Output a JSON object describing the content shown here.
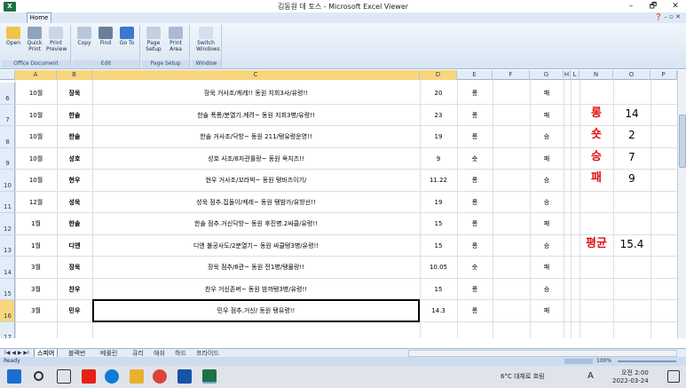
{
  "window": {
    "title": "김동원 데 토스 - Microsoft Excel Viewer",
    "app_icon": "X",
    "minimize": "–",
    "maximize": "🗗",
    "close": "✕"
  },
  "ribbon": {
    "tab": "Home",
    "mini_controls": "❓ – ▫ ✕",
    "groups": [
      {
        "label": "Office Document",
        "buttons": [
          "Open",
          "Quick Print",
          "Print Preview"
        ]
      },
      {
        "label": "Edit",
        "buttons": [
          "Copy",
          "Find",
          "Go To"
        ]
      },
      {
        "label": "Page Setup",
        "buttons": [
          "Page Setup",
          "Print Area"
        ]
      },
      {
        "label": "Window",
        "buttons": [
          "Switch Windows"
        ]
      }
    ]
  },
  "columns": [
    "A",
    "B",
    "C",
    "D",
    "E",
    "F",
    "G",
    "H",
    "L",
    "N",
    "O",
    "P"
  ],
  "rows": [
    {
      "num": "6",
      "a": "10월",
      "b": "장욱",
      "c": "장욱 거사조/케레!! 동원 지회3사/유령!!",
      "d": "20",
      "e": "롱",
      "g": "패"
    },
    {
      "num": "7",
      "a": "10월",
      "b": "한솔",
      "c": "한솔 폭룡/분열기.케려~ 동원 지회3병/유령!!",
      "d": "23",
      "e": "롱",
      "g": "패"
    },
    {
      "num": "8",
      "a": "10월",
      "b": "한솔",
      "c": "한솔 거사조/닥방~ 동원 211/탱유령운영!!",
      "d": "19",
      "e": "롱",
      "g": "승"
    },
    {
      "num": "9",
      "a": "10월",
      "b": "성호",
      "c": "성호 사조/8자관률랑~ 동원 옥지즈!!",
      "d": "9",
      "e": "숏",
      "g": "패"
    },
    {
      "num": "10",
      "a": "10월",
      "b": "현우",
      "c": "현우 거사조/꼬라박~ 동원 탱바즈이기/",
      "d": "11.22",
      "e": "롱",
      "g": "승"
    },
    {
      "num": "11",
      "a": "12월",
      "b": "성욱",
      "c": "성욱 점추.집돌이/케레~ 동원 탱밤가/유방선!!",
      "d": "19",
      "e": "롱",
      "g": "승"
    },
    {
      "num": "12",
      "a": "1월",
      "b": "한솔",
      "c": "한솔 점추.거신닥방~ 동원 후진병.2싸클/유령!!",
      "d": "15",
      "e": "롱",
      "g": "패"
    },
    {
      "num": "13",
      "a": "1월",
      "b": "디엔",
      "c": "디엔 불공사도/2분열기~ 동원 싸클탱3병/유령!!",
      "d": "15",
      "e": "롱",
      "g": "승"
    },
    {
      "num": "14",
      "a": "3월",
      "b": "장욱",
      "c": "장욱 점추/8관~ 동원 전1병/탱몰랑!!",
      "d": "10.05",
      "e": "숏",
      "g": "패"
    },
    {
      "num": "15",
      "a": "3월",
      "b": "찬우",
      "c": "찬우 거신존버~ 동원 밤까탱3병/유령!!",
      "d": "15",
      "e": "롱",
      "g": "승"
    },
    {
      "num": "16",
      "a": "3월",
      "b": "민우",
      "c": "민우 점추.거신/ 동원 탱유령!!",
      "d": "14.3",
      "e": "롱",
      "g": "패"
    },
    {
      "num": "17",
      "a": "",
      "b": "",
      "c": "",
      "d": "",
      "e": "",
      "g": ""
    }
  ],
  "stats": [
    {
      "label": "롱",
      "value": "14"
    },
    {
      "label": "숏",
      "value": "2"
    },
    {
      "label": "승",
      "value": "7"
    },
    {
      "label": "패",
      "value": "9"
    }
  ],
  "average": {
    "label": "평균",
    "value": "15.4"
  },
  "sheet_tabs": [
    "스피어",
    "블랙번",
    "베룰린",
    "큐리",
    "애쉬",
    "하드",
    "프라이드"
  ],
  "tab_nav": "I◀ ◀ ▶ ▶I",
  "status": {
    "left": "Ready",
    "zoom": "100%"
  },
  "taskbar": {
    "weather": "6°C 대체로 흐림",
    "ime": "A",
    "time": "오전 2:00",
    "date": "2022-03-24"
  },
  "colors": {
    "red_text": "#e01010",
    "ribbon_blue": "#dfe9f5",
    "selected_header": "#f8d67e"
  }
}
